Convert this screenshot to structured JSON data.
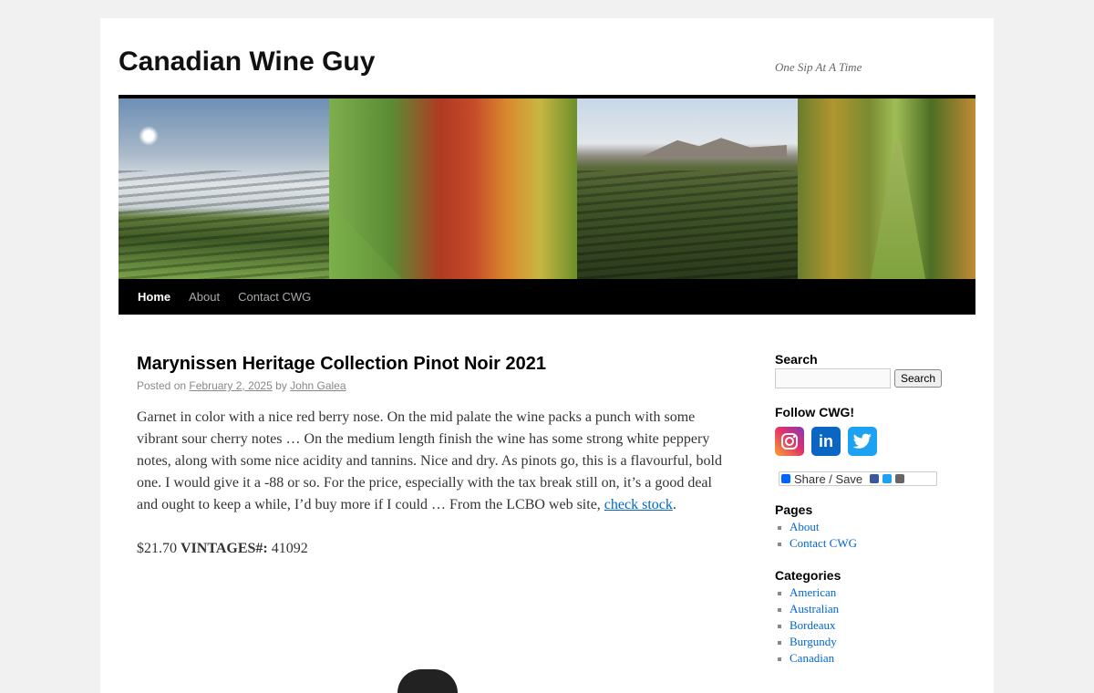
{
  "site": {
    "title": "Canadian Wine Guy",
    "description": "One Sip At A Time"
  },
  "nav": {
    "items": [
      {
        "label": "Home",
        "current": true
      },
      {
        "label": "About"
      },
      {
        "label": "Contact CWG"
      }
    ]
  },
  "post": {
    "title": "Marynissen Heritage Collection Pinot Noir 2021",
    "meta_posted": "Posted on",
    "meta_date": "February 2, 2025",
    "meta_by": "by",
    "meta_author": "John Galea",
    "body_text": "Garnet in color with a nice red berry nose. On the mid palate the wine packs a punch with some vibrant sour cherry notes … On the medium length finish the wine has some strong white peppery notes, along with some nice acidity and tannins. Nice and dry. As pinots go, this is a flavourful, bold one. I would give it a -88 or so. For the price, especially with the tax break still on, it’s a good deal and ought to keep a while, I’d buy more if I could … From the LCBO web site,",
    "check_stock_link": "check stock",
    "body_end": ".",
    "price": "$21.70",
    "vintages_label": "VINTAGES#:",
    "vintages_number": "41092"
  },
  "sidebar": {
    "search_title": "Search",
    "search_value": "",
    "search_button": "Search",
    "follow_title": "Follow CWG!",
    "social": [
      "instagram-icon",
      "linkedin-icon",
      "twitter-icon"
    ],
    "share_label": "Share / Save",
    "pages_title": "Pages",
    "pages": [
      "About",
      "Contact CWG"
    ],
    "categories_title": "Categories",
    "categories": [
      "American",
      "Australian",
      "Bordeaux",
      "Burgundy",
      "Canadian"
    ]
  }
}
